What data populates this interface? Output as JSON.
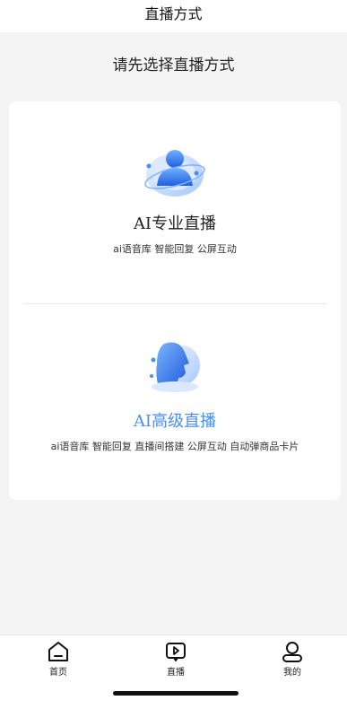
{
  "navbar": {
    "title": "直播方式"
  },
  "page": {
    "heading": "请先选择直播方式"
  },
  "options": [
    {
      "title": "AI专业直播",
      "features": "ai语音库 智能回复 公屏互动",
      "icon": "ai-orbit-user-icon"
    },
    {
      "title": "AI高级直播",
      "features": "ai语音库 智能回复 直播间搭建 公屏互动 自动弹商品卡片",
      "icon": "ai-head-profile-icon",
      "accent": "#4a8ff5"
    }
  ],
  "tabbar": {
    "items": [
      {
        "label": "首页",
        "icon": "home-icon"
      },
      {
        "label": "直播",
        "icon": "live-play-icon"
      },
      {
        "label": "我的",
        "icon": "user-icon"
      }
    ]
  },
  "colors": {
    "accent": "#4a8ff5",
    "background": "#f4f4f5"
  }
}
